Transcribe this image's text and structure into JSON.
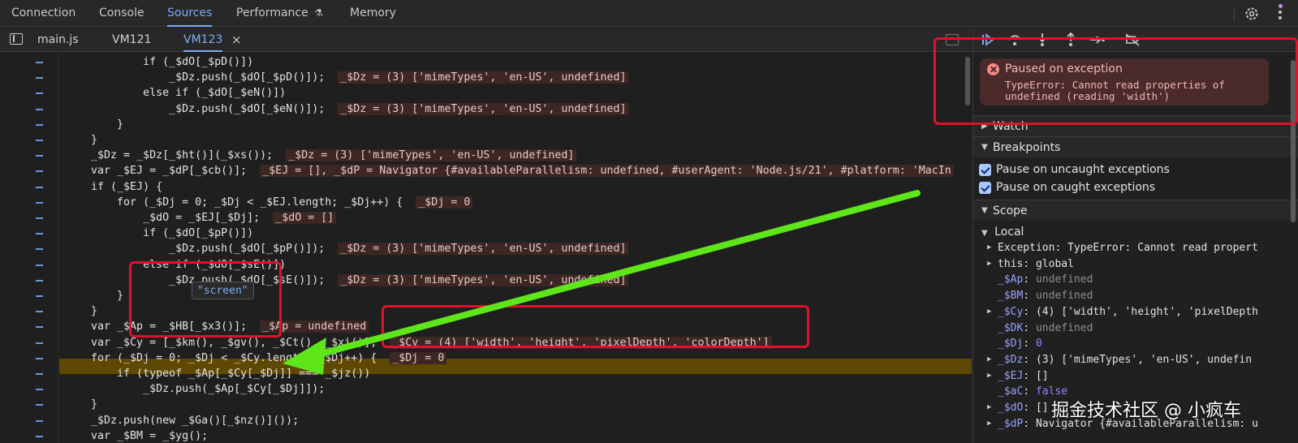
{
  "main_tabs": [
    "Connection",
    "Console",
    "Sources",
    "Performance",
    "Memory"
  ],
  "active_main_tab": "Sources",
  "file_tabs": [
    "main.js",
    "VM121",
    "VM123"
  ],
  "active_file_tab": "VM123",
  "close_glyph": "×",
  "code_lines": [
    {
      "text": "            if (_$dO[_$pD()])",
      "inline": ""
    },
    {
      "text": "                _$Dz.push(_$dO[_$pD()]);",
      "inline": "_$Dz = (3) ['mimeTypes', 'en-US', undefined]"
    },
    {
      "text": "            else if (_$dO[_$eN()])",
      "inline": ""
    },
    {
      "text": "                _$Dz.push(_$dO[_$eN()]);",
      "inline": "_$Dz = (3) ['mimeTypes', 'en-US', undefined]"
    },
    {
      "text": "        }",
      "inline": ""
    },
    {
      "text": "    }",
      "inline": ""
    },
    {
      "text": "    _$Dz = _$Dz[_$ht()](_$xs());",
      "inline": "_$Dz = (3) ['mimeTypes', 'en-US', undefined]"
    },
    {
      "text": "    var _$EJ = _$dP[_$cb()];",
      "inline": "_$EJ = [], _$dP = Navigator {#availableParallelism: undefined, #userAgent: 'Node.js/21', #platform: 'MacIn"
    },
    {
      "text": "    if (_$EJ) {",
      "inline": ""
    },
    {
      "text": "        for (_$Dj = 0; _$Dj < _$EJ.length; _$Dj++) {",
      "inline": "_$Dj = 0"
    },
    {
      "text": "            _$dO = _$EJ[_$Dj];",
      "inline": "_$dO = []"
    },
    {
      "text": "            if (_$dO[_$pP()])",
      "inline": ""
    },
    {
      "text": "                _$Dz.push(_$dO[_$pP()]);",
      "inline": "_$Dz = (3) ['mimeTypes', 'en-US', undefined]"
    },
    {
      "text": "            else if (_$dO[_$sE()])",
      "inline": ""
    },
    {
      "text": "                _$Dz.push(_$dO[_$sE()]);",
      "inline": "_$Dz = (3) ['mimeTypes', 'en-US', undefined]"
    },
    {
      "text": "        }",
      "inline": ""
    },
    {
      "text": "    }",
      "inline": ""
    },
    {
      "text": "    var _$Ap = _$HB[_$x3()];",
      "inline": "_$Ap = undefined"
    },
    {
      "text": "    var _$Cy = [_$km(), _$gv(), _$Ct(), _$xi()];",
      "inline": "_$Cy = (4) ['width', 'height', 'pixelDepth', 'colorDepth']"
    },
    {
      "text": "    for (_$Dj = 0; _$Dj < _$Cy.length; _$Dj++) {",
      "inline": "_$Dj = 0"
    },
    {
      "text": "        if (typeof _$Ap[_$Cy[_$Dj]] === _$jz())",
      "inline": ""
    },
    {
      "text": "            _$Dz.push(_$Ap[_$Cy[_$Dj]]);",
      "inline": ""
    },
    {
      "text": "    }",
      "inline": ""
    },
    {
      "text": "    _$Dz.push(new _$Ga()[_$nz()]());",
      "inline": ""
    },
    {
      "text": "    var _$BM = _$yg();",
      "inline": ""
    }
  ],
  "tooltip": "\"screen\"",
  "paused": {
    "title": "Paused on exception",
    "message": "TypeError: Cannot read properties of undefined (reading 'width')"
  },
  "sections": {
    "watch": "Watch",
    "breakpoints": "Breakpoints",
    "scope": "Scope",
    "local": "Local"
  },
  "breakpoint_options": [
    {
      "label": "Pause on uncaught exceptions",
      "checked": true
    },
    {
      "label": "Pause on caught exceptions",
      "checked": true
    }
  ],
  "scope_vars": [
    {
      "name": "Exception",
      "value": "TypeError: Cannot read propert",
      "expandable": true,
      "kind": "plain"
    },
    {
      "name": "this",
      "value": "global",
      "expandable": true,
      "kind": "plain"
    },
    {
      "name": "_$Ap",
      "value": "undefined",
      "expandable": false,
      "kind": "undef"
    },
    {
      "name": "_$BM",
      "value": "undefined",
      "expandable": false,
      "kind": "undef"
    },
    {
      "name": "_$Cy",
      "value": "(4) ['width', 'height', 'pixelDepth",
      "expandable": true,
      "kind": "arr"
    },
    {
      "name": "_$DK",
      "value": "undefined",
      "expandable": false,
      "kind": "undef"
    },
    {
      "name": "_$Dj",
      "value": "0",
      "expandable": false,
      "kind": "num"
    },
    {
      "name": "_$Dz",
      "value": "(3) ['mimeTypes', 'en-US', undefin",
      "expandable": true,
      "kind": "arr"
    },
    {
      "name": "_$EJ",
      "value": "[]",
      "expandable": true,
      "kind": "plain"
    },
    {
      "name": "_$aC",
      "value": "false",
      "expandable": false,
      "kind": "num"
    },
    {
      "name": "_$dO",
      "value": "[]",
      "expandable": true,
      "kind": "plain"
    },
    {
      "name": "_$dP",
      "value": "Navigator {#availableParallelism: u",
      "expandable": true,
      "kind": "plain"
    }
  ],
  "watermark": "掘金技术社区 @ 小疯车",
  "colors": {
    "accent": "#7cacf8",
    "annotation_red": "#e3102a",
    "annotation_arrow": "#5fe61a",
    "exception_line": "#6b4f00"
  }
}
